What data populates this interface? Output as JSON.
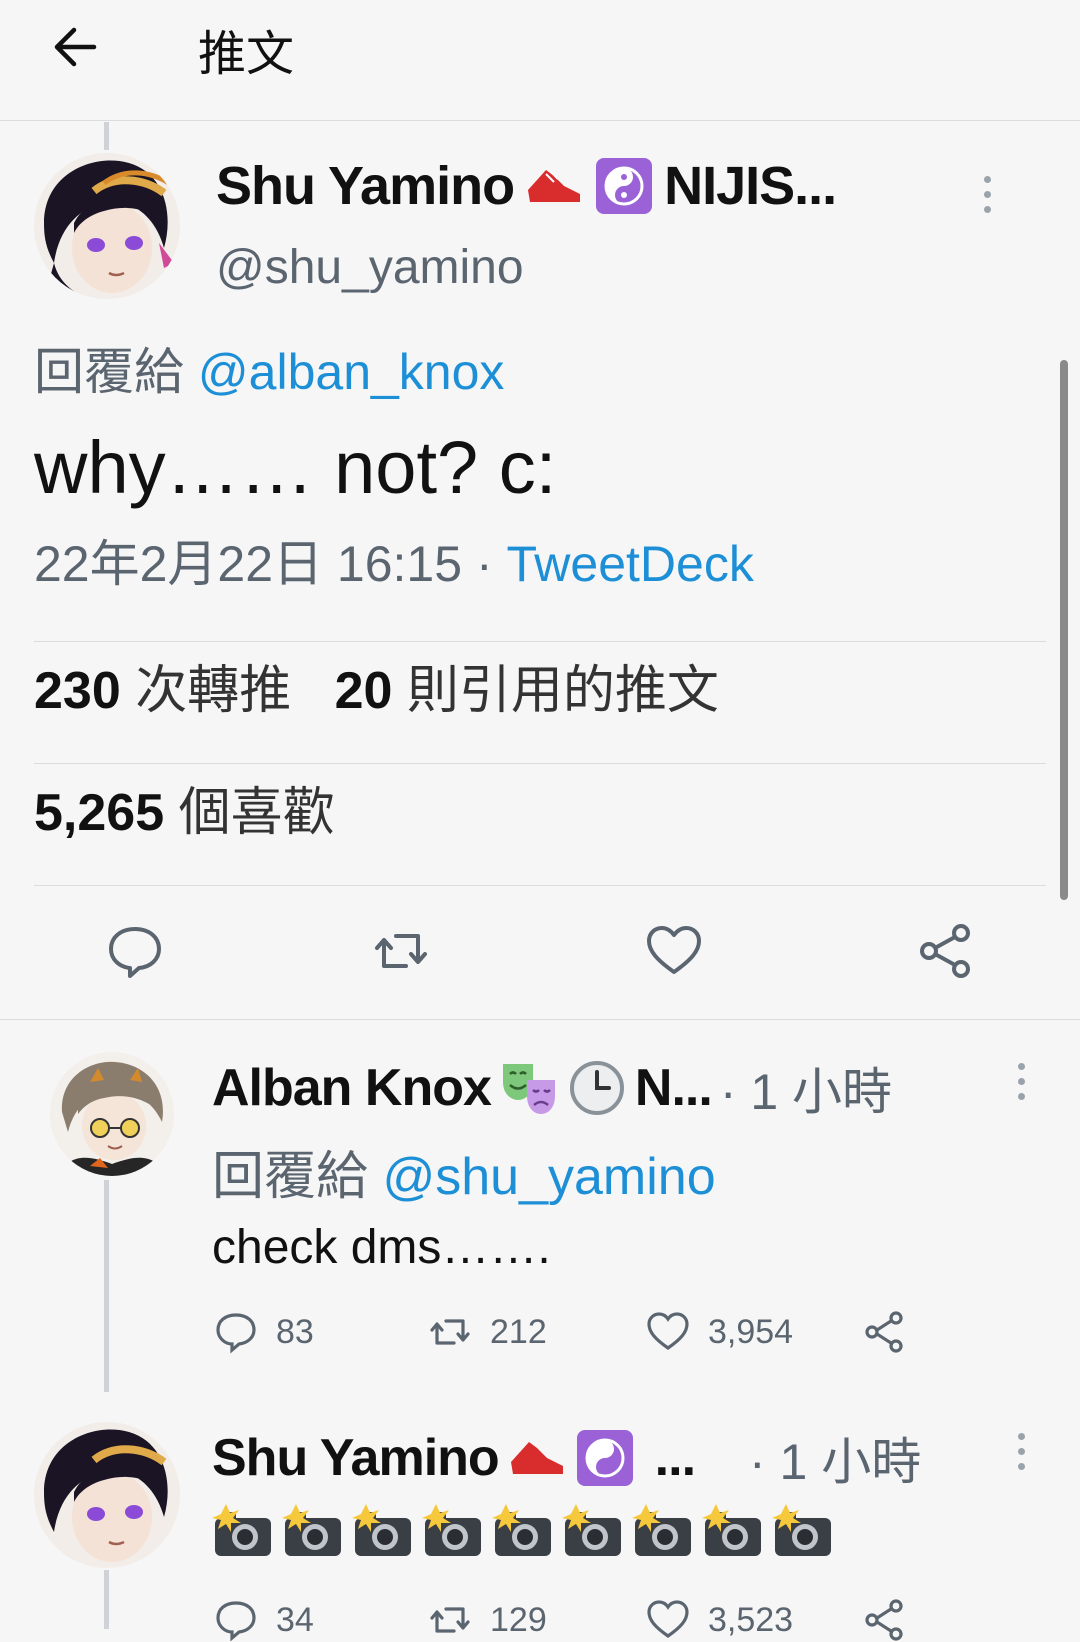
{
  "header": {
    "title": "推文"
  },
  "main_tweet": {
    "name": "Shu Yamino",
    "name_suffix": "NIJIS...",
    "handle": "@shu_yamino",
    "reply_prefix": "回覆給",
    "reply_to": "@alban_knox",
    "text": "why…… not? c:",
    "timestamp": "22年2月22日 16:15 · ",
    "client": "TweetDeck",
    "retweets_count": "230",
    "retweets_label": "次轉推",
    "quotes_count": "20",
    "quotes_label": "則引用的推文",
    "likes_count": "5,265",
    "likes_label": "個喜歡"
  },
  "replies": [
    {
      "name": "Alban Knox",
      "name_suffix": "N...",
      "time": "· 1 小時",
      "reply_prefix": "回覆給",
      "reply_to": "@shu_yamino",
      "text": "check dms…….",
      "replies": "83",
      "retweets": "212",
      "likes": "3,954"
    },
    {
      "name": "Shu Yamino",
      "name_suffix": "...",
      "time": "· 1 小時",
      "replies": "34",
      "retweets": "129",
      "likes": "3,523"
    }
  ],
  "colors": {
    "link": "#1d8fd6",
    "muted": "#5b6570",
    "background": "#f6f6f6"
  }
}
